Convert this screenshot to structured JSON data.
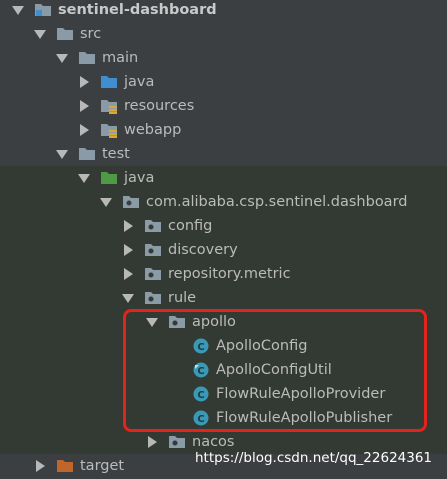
{
  "tree": {
    "project": "sentinel-dashboard",
    "src": "src",
    "main": "main",
    "java_main": "java",
    "resources": "resources",
    "webapp": "webapp",
    "test": "test",
    "java_test": "java",
    "package": "com.alibaba.csp.sentinel.dashboard",
    "config": "config",
    "discovery": "discovery",
    "repository_metric": "repository.metric",
    "rule": "rule",
    "apollo": "apollo",
    "apollo_classes": [
      "ApolloConfig",
      "ApolloConfigUtil",
      "FlowRuleApolloProvider",
      "FlowRuleApolloPublisher"
    ],
    "nacos": "nacos",
    "target": "target"
  },
  "watermark": "https://blog.csdn.net/qq_22624361",
  "colors": {
    "background": "#3c3f41",
    "test_background": "#333a33",
    "folder": "#8a9aa6",
    "source_folder": "#3f8fd0",
    "test_folder": "#4f9a44",
    "class_icon": "#3a9ab5",
    "target_folder": "#c0662d",
    "highlight_box": "#e3231c"
  }
}
